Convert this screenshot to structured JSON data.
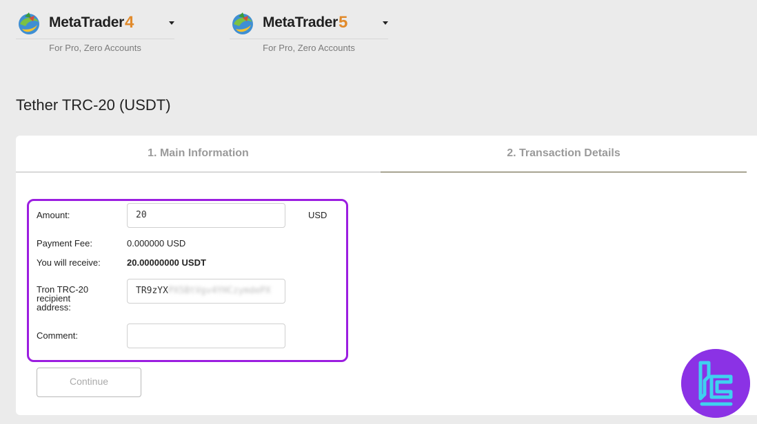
{
  "platforms": [
    {
      "name": "MetaTrader",
      "version": "4",
      "subtitle": "For Pro, Zero Accounts"
    },
    {
      "name": "MetaTrader",
      "version": "5",
      "subtitle": "For Pro, Zero Accounts"
    }
  ],
  "page": {
    "title": "Tether TRC-20 (USDT)"
  },
  "tabs": [
    {
      "label": "1. Main Information"
    },
    {
      "label": "2. Transaction Details"
    }
  ],
  "form": {
    "amount_label": "Amount:",
    "amount_value": "20",
    "currency": "USD",
    "fee_label": "Payment Fee:",
    "fee_value": "0.000000 USD",
    "receive_label": "You will receive:",
    "receive_value": "20.00000000 USDT",
    "address_label": "Tron TRC-20 recipient address:",
    "address_visible": "TR9zYX",
    "address_hidden": "PX5BtVgv4YHCzymdePX",
    "comment_label": "Comment:",
    "comment_value": "",
    "continue_label": "Continue"
  },
  "colors": {
    "highlight": "#9b1de0",
    "accent": "#e18a2b",
    "badge": "#8b32e5"
  }
}
